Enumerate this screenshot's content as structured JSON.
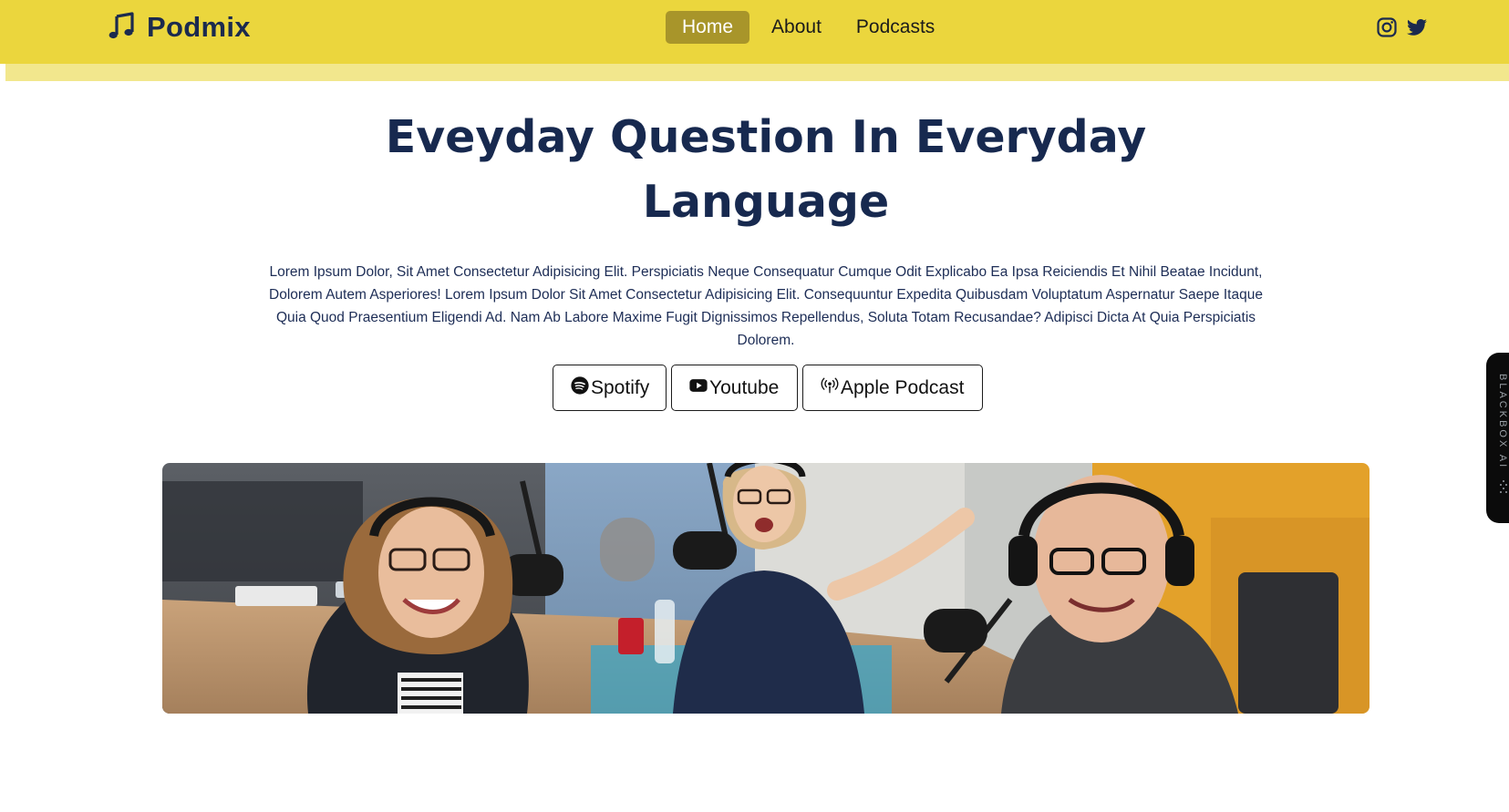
{
  "brand": {
    "name": "Podmix",
    "icon": "music-note-icon"
  },
  "nav": {
    "items": [
      {
        "label": "Home",
        "active": true
      },
      {
        "label": "About",
        "active": false
      },
      {
        "label": "Podcasts",
        "active": false
      }
    ]
  },
  "socials": [
    {
      "icon": "instagram-icon"
    },
    {
      "icon": "twitter-icon"
    }
  ],
  "hero": {
    "title_line1": "Eveyday Question In Everyday",
    "title_line2": "Language",
    "description": "Lorem Ipsum Dolor, Sit Amet Consectetur Adipisicing Elit. Perspiciatis Neque Consequatur Cumque Odit Explicabo Ea Ipsa Reiciendis Et Nihil Beatae Incidunt, Dolorem Autem Asperiores! Lorem Ipsum Dolor Sit Amet Consectetur Adipisicing Elit. Consequuntur Expedita Quibusdam Voluptatum Aspernatur Saepe Itaque Quia Quod Praesentium Eligendi Ad. Nam Ab Labore Maxime Fugit Dignissimos Repellendus, Soluta Totam Recusandae? Adipisci Dicta At Quia Perspiciatis Dolorem."
  },
  "buttons": [
    {
      "label": "Spotify",
      "icon": "spotify-icon"
    },
    {
      "label": "Youtube",
      "icon": "youtube-icon"
    },
    {
      "label": "Apple Podcast",
      "icon": "podcast-icon"
    }
  ],
  "side_tab": {
    "label": "BLACKBOX AI"
  },
  "colors": {
    "navbar": "#ebd63d",
    "subbar": "#f2e78d",
    "active_nav": "#a8952a",
    "heading": "#17294f"
  }
}
